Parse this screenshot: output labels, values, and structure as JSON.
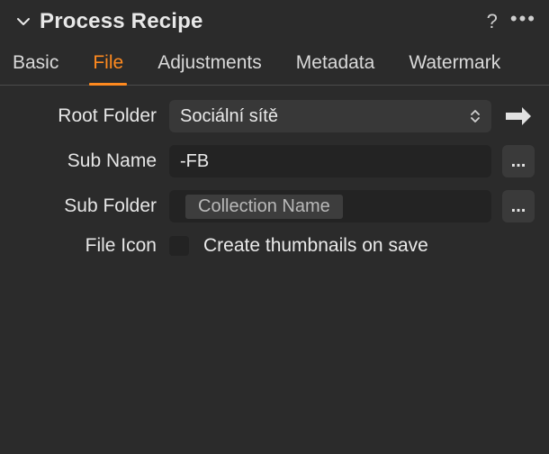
{
  "header": {
    "title": "Process Recipe"
  },
  "tabs": {
    "basic": "Basic",
    "file": "File",
    "adjustments": "Adjustments",
    "metadata": "Metadata",
    "watermark": "Watermark",
    "active": "file"
  },
  "form": {
    "root_folder": {
      "label": "Root Folder",
      "value": "Sociální sítě"
    },
    "sub_name": {
      "label": "Sub Name",
      "value": "-FB"
    },
    "sub_folder": {
      "label": "Sub Folder",
      "token": "Collection Name"
    },
    "file_icon": {
      "label": "File Icon",
      "checkbox_label": "Create thumbnails on save",
      "checked": false
    }
  },
  "buttons": {
    "more": "...",
    "more2": "..."
  }
}
